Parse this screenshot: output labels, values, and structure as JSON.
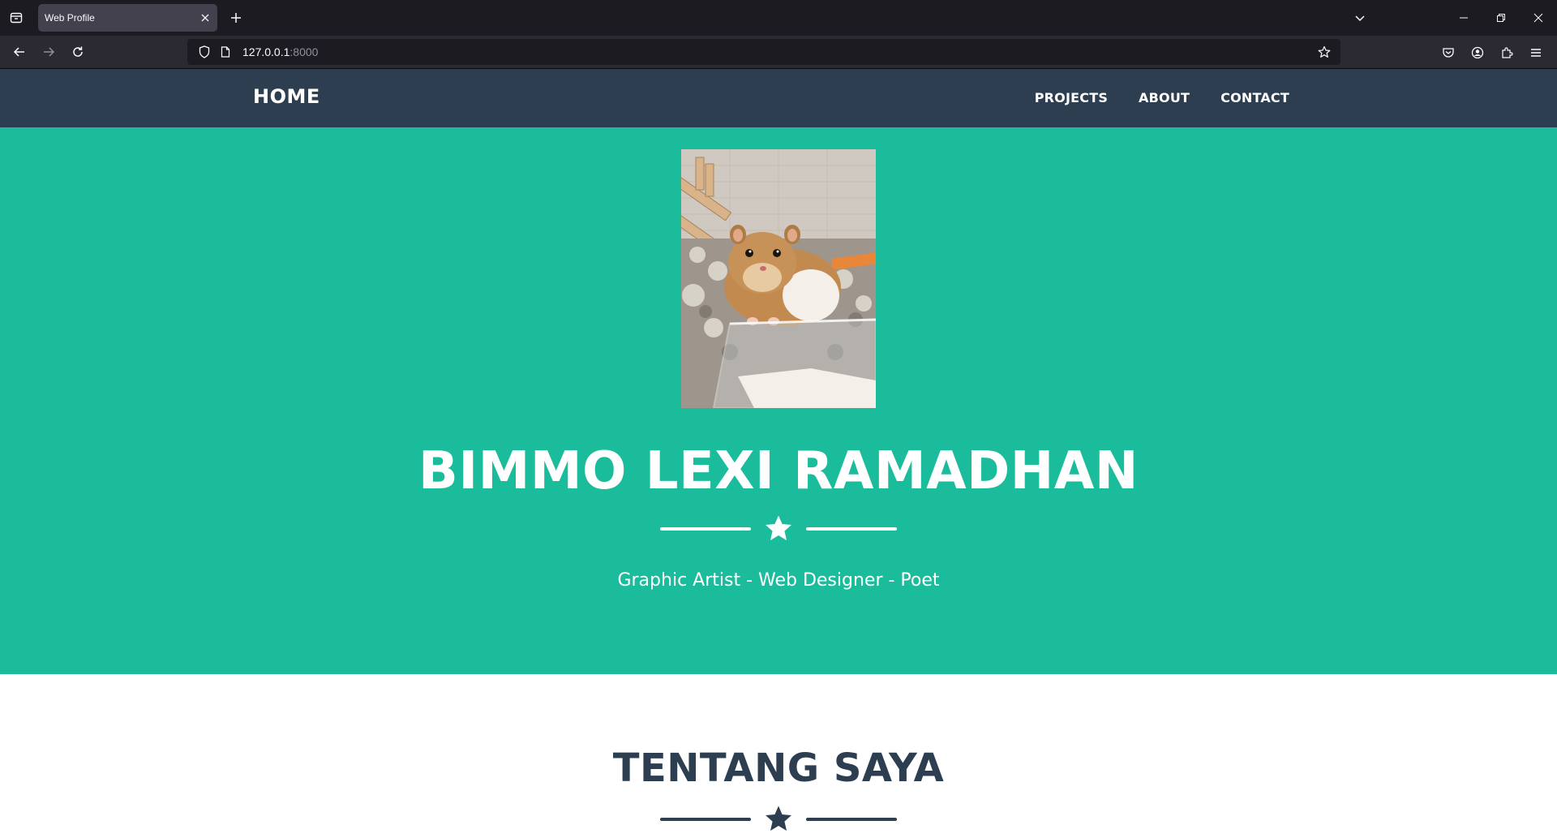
{
  "browser": {
    "tab_title": "Web Profile",
    "url_host": "127.0.0.1",
    "url_port": ":8000",
    "icons": {
      "tab_list": "tab-list-icon",
      "close_tab": "close-icon",
      "new_tab": "plus-icon",
      "list_all_tabs": "chevron-down-icon",
      "minimize": "minimize-icon",
      "restore": "restore-icon",
      "close_window": "close-icon",
      "back": "back-arrow-icon",
      "forward": "forward-arrow-icon",
      "reload": "reload-icon",
      "shield": "shield-icon",
      "page": "page-icon",
      "bookmark": "star-icon",
      "pocket": "pocket-icon",
      "account": "account-icon",
      "extensions": "puzzle-icon",
      "menu": "hamburger-menu-icon"
    }
  },
  "site": {
    "brand": "HOME",
    "links": [
      "PROJECTS",
      "ABOUT",
      "CONTACT"
    ],
    "colors": {
      "nav_bg": "#2c3e50",
      "masthead_bg": "#1abc9c",
      "text_dark": "#2c3e50",
      "text_light": "#ffffff"
    }
  },
  "masthead": {
    "image": "hamster-photo",
    "title": "BIMMO LEXI RAMADHAN",
    "subtitle": "Graphic Artist - Web Designer - Poet",
    "divider_icon": "star-icon"
  },
  "about": {
    "title": "TENTANG SAYA",
    "divider_icon": "star-icon"
  }
}
